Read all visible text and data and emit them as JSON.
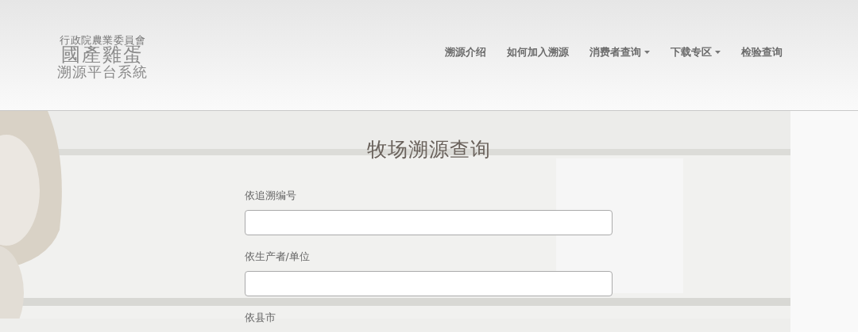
{
  "logo": {
    "agency": "行政院農業委員會",
    "title": "國產雞蛋",
    "subtitle": "溯源平台系統"
  },
  "nav": [
    {
      "label": "溯源介绍",
      "dropdown": false
    },
    {
      "label": "如何加入溯源",
      "dropdown": false
    },
    {
      "label": "消费者查询",
      "dropdown": true
    },
    {
      "label": "下载专区",
      "dropdown": true
    },
    {
      "label": "检验查询",
      "dropdown": false
    }
  ],
  "page_title": "牧场溯源查询",
  "fields": [
    {
      "label": "依追溯编号",
      "kind": "input"
    },
    {
      "label": "依生产者/单位",
      "kind": "input"
    },
    {
      "label": "依县市",
      "kind": "label"
    }
  ]
}
